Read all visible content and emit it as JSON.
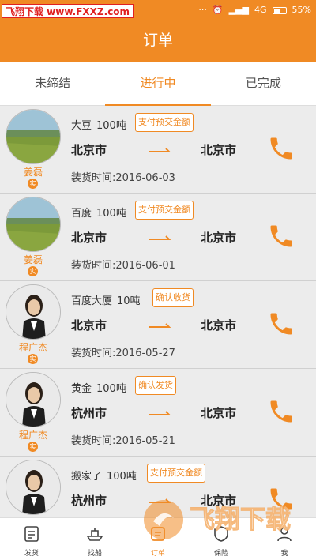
{
  "status_bar": {
    "watermark": "飞翔下载 www.FXXZ.com",
    "network": "4G",
    "battery": "55%"
  },
  "header": {
    "title": "订单"
  },
  "tabs": [
    {
      "label": "未缔结",
      "active": false
    },
    {
      "label": "进行中",
      "active": true
    },
    {
      "label": "已完成",
      "active": false
    }
  ],
  "orders": [
    {
      "name": "姜磊",
      "verified": "实",
      "cargo": "大豆",
      "weight": "100吨",
      "action": "支付预交金额",
      "from": "北京市",
      "to": "北京市",
      "date": "装货时间:2016-06-03",
      "avatar": "landscape-photo"
    },
    {
      "name": "姜磊",
      "verified": "实",
      "cargo": "百度",
      "weight": "100吨",
      "action": "支付预交金额",
      "from": "北京市",
      "to": "北京市",
      "date": "装货时间:2016-06-01",
      "avatar": "landscape-photo"
    },
    {
      "name": "程广杰",
      "verified": "实",
      "cargo": "百度大厦",
      "weight": "10吨",
      "action": "确认收货",
      "from": "北京市",
      "to": "北京市",
      "date": "装货时间:2016-05-27",
      "avatar": "woman-photo"
    },
    {
      "name": "程广杰",
      "verified": "实",
      "cargo": "黄金",
      "weight": "100吨",
      "action": "确认发货",
      "from": "杭州市",
      "to": "北京市",
      "date": "装货时间:2016-05-21",
      "avatar": "woman-photo"
    },
    {
      "name": "",
      "verified": "",
      "cargo": "搬家了",
      "weight": "100吨",
      "action": "支付预交金额",
      "from": "杭州市",
      "to": "北京市",
      "date": "",
      "avatar": "woman-photo"
    }
  ],
  "bottom_nav": [
    {
      "label": "发货",
      "icon": "document-icon",
      "active": false
    },
    {
      "label": "找船",
      "icon": "ship-icon",
      "active": false
    },
    {
      "label": "订单",
      "icon": "order-icon",
      "active": true
    },
    {
      "label": "保险",
      "icon": "insurance-icon",
      "active": false
    },
    {
      "label": "我",
      "icon": "user-icon",
      "active": false
    }
  ],
  "watermark_overlay": "飞翔下载 www.FXXZ.com",
  "colors": {
    "accent": "#f08a24",
    "background": "#ececec"
  }
}
